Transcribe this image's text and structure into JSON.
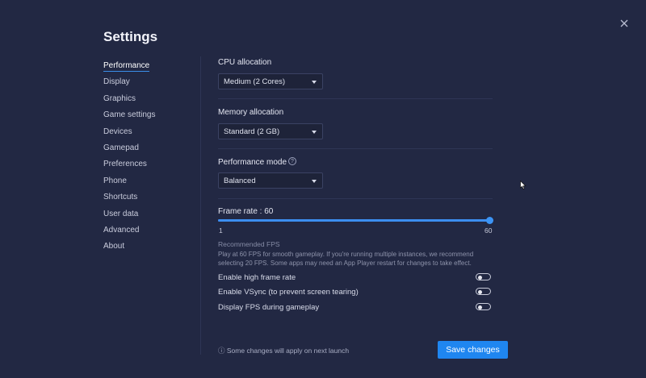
{
  "title": "Settings",
  "sidebar": {
    "items": [
      {
        "label": "Performance",
        "active": true
      },
      {
        "label": "Display"
      },
      {
        "label": "Graphics"
      },
      {
        "label": "Game settings"
      },
      {
        "label": "Devices"
      },
      {
        "label": "Gamepad"
      },
      {
        "label": "Preferences"
      },
      {
        "label": "Phone"
      },
      {
        "label": "Shortcuts"
      },
      {
        "label": "User data"
      },
      {
        "label": "Advanced"
      },
      {
        "label": "About"
      }
    ]
  },
  "performance": {
    "cpu": {
      "label": "CPU allocation",
      "value": "Medium (2 Cores)"
    },
    "memory": {
      "label": "Memory allocation",
      "value": "Standard (2 GB)"
    },
    "mode": {
      "label": "Performance mode",
      "help_icon": "?",
      "value": "Balanced"
    },
    "frame_rate": {
      "label": "Frame rate : 60",
      "value": 60,
      "min": 1,
      "max": 60,
      "min_label": "1",
      "max_label": "60"
    },
    "recommended_title": "Recommended FPS",
    "recommended_text": "Play at 60 FPS for smooth gameplay. If you're running multiple instances, we recommend selecting 20 FPS. Some apps may need an App Player restart for changes to take effect.",
    "toggles": [
      {
        "label": "Enable high frame rate",
        "on": false
      },
      {
        "label": "Enable VSync (to prevent screen tearing)",
        "on": false
      },
      {
        "label": "Display FPS during gameplay",
        "on": false
      }
    ]
  },
  "footer": {
    "note_icon": "ⓘ",
    "note": "Some changes will apply on next launch",
    "save_label": "Save changes"
  },
  "colors": {
    "background": "#222843",
    "accent": "#1f86f0",
    "text": "#e6e8f2",
    "muted": "#8e93ab"
  },
  "icons": [
    "close-icon",
    "help-icon",
    "caret-down-icon",
    "info-icon",
    "mouse-cursor-icon"
  ]
}
